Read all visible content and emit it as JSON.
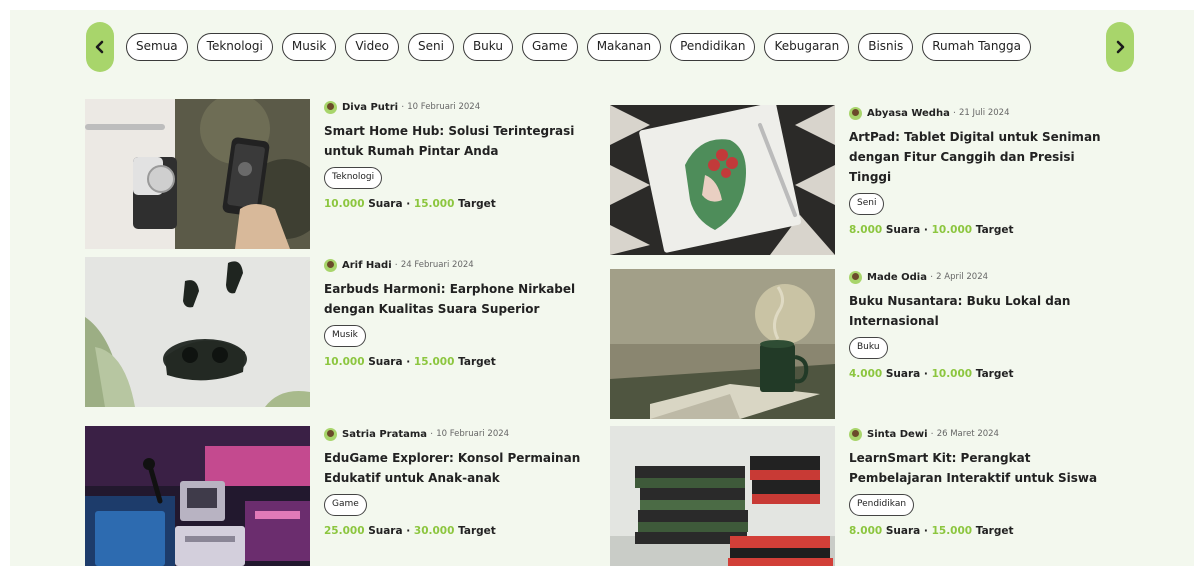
{
  "categories": [
    "Semua",
    "Teknologi",
    "Musik",
    "Video",
    "Seni",
    "Buku",
    "Game",
    "Makanan",
    "Pendidikan",
    "Kebugaran",
    "Bisnis",
    "Rumah Tangga"
  ],
  "votes_label": "Suara",
  "target_label": "Target",
  "cards": [
    {
      "author": "Diva Putri",
      "date": "10 Februari 2024",
      "title": "Smart Home Hub: Solusi Terintegrasi untuk Rumah Pintar Anda",
      "tag": "Teknologi",
      "votes": "10.000",
      "target": "15.000"
    },
    {
      "author": "Abyasa Wedha",
      "date": "21 Juli 2024",
      "title": "ArtPad: Tablet Digital untuk Seniman dengan Fitur Canggih dan Presisi Tinggi",
      "tag": "Seni",
      "votes": "8.000",
      "target": "10.000"
    },
    {
      "author": "Arif Hadi",
      "date": "24 Februari 2024",
      "title": "Earbuds Harmoni: Earphone Nirkabel dengan Kualitas Suara Superior",
      "tag": "Musik",
      "votes": "10.000",
      "target": "15.000"
    },
    {
      "author": "Made Odia",
      "date": "2 April 2024",
      "title": "Buku Nusantara: Buku Lokal dan Internasional",
      "tag": "Buku",
      "votes": "4.000",
      "target": "10.000"
    },
    {
      "author": "Satria Pratama",
      "date": "10 Februari 2024",
      "title": "EduGame Explorer: Konsol Permainan Edukatif untuk Anak-anak",
      "tag": "Game",
      "votes": "25.000",
      "target": "30.000"
    },
    {
      "author": "Sinta Dewi",
      "date": "26 Maret 2024",
      "title": "LearnSmart Kit: Perangkat Pembelajaran Interaktif untuk Siswa",
      "tag": "Pendidikan",
      "votes": "8.000",
      "target": "15.000"
    }
  ],
  "colors": {
    "accent": "#a8d56b",
    "highlight": "#8cc63f",
    "background": "#f3f8ee"
  },
  "icons": {
    "prev": "chevron-left-icon",
    "next": "chevron-right-icon",
    "avatar": "user-avatar"
  }
}
